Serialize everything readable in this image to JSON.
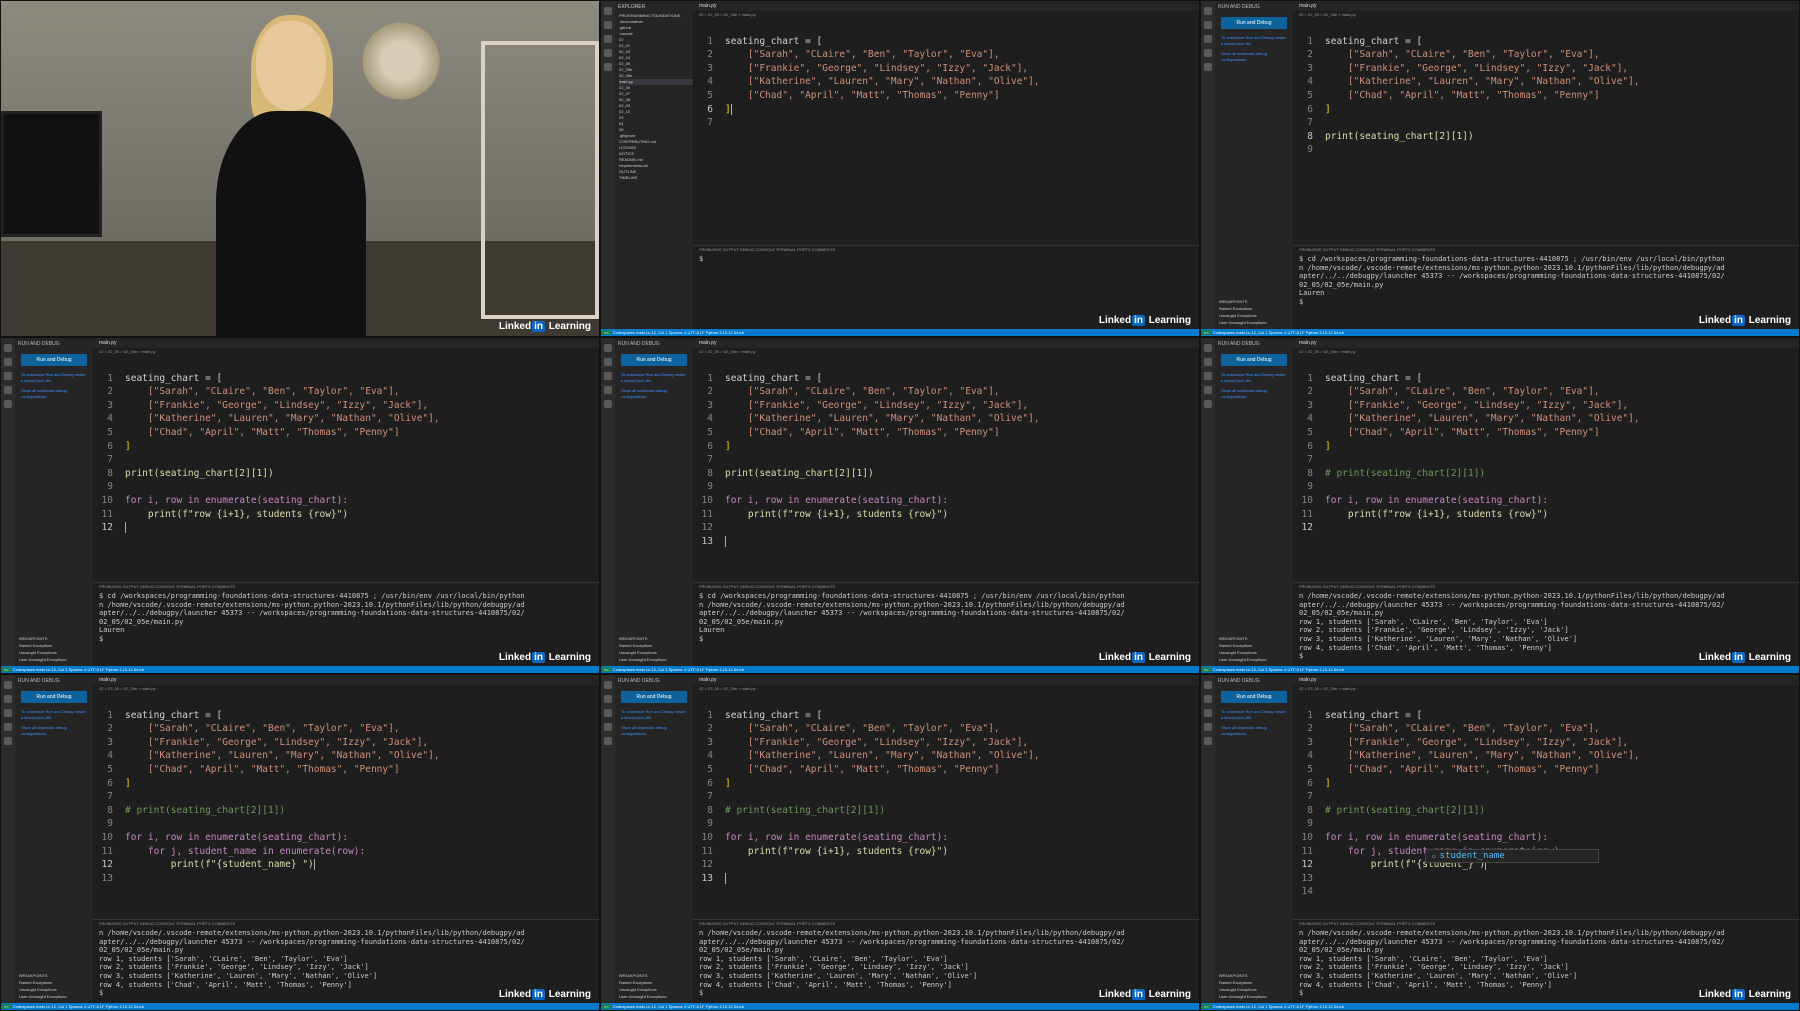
{
  "watermark": {
    "prefix": "Linked",
    "badge": "in",
    "suffix": "Learning"
  },
  "ui": {
    "run_title": "RUN AND DEBUG",
    "explorer_title": "EXPLORER",
    "run_button": "Run and Debug",
    "run_hint": "To customize Run and Debug create a launch.json file.",
    "show_auto": "Show all automatic debug configurations.",
    "tab_label": "main.py",
    "breadcrumb": "02 > 02_05 > 02_05e > main.py",
    "panel_tabs": "PROBLEMS   OUTPUT   DEBUG CONSOLE   TERMINAL   PORTS   COMMENTS",
    "breakpoints": [
      "BREAKPOINTS",
      "Raised Exceptions",
      "Uncaught Exceptions",
      "User Uncaught Exceptions"
    ],
    "status": "Codespaces   main   Ln 12, Col 1   Spaces: 4   UTF-8   LF   Python   3.10.12 64-bit"
  },
  "explorer_tree": [
    "PROGRAMMING-FOUNDATIONS",
    ".devcontainer",
    ".github",
    ".vscode",
    "02",
    "02_01",
    "02_03",
    "02_04",
    "02_05",
    "02_05b",
    "02_05e",
    "main.py",
    "02_06",
    "02_07",
    "02_08",
    "02_09",
    "02_10",
    "03",
    "04",
    "05",
    ".gitignore",
    "CONTRIBUTING.md",
    "LICENSE",
    "NOTICE",
    "README.md",
    "requirements.txt",
    "OUTLINE",
    "TIMELINE"
  ],
  "code": {
    "chart_open": "seating_chart = [",
    "row1": "[\"Sarah\", \"CLaire\", \"Ben\", \"Taylor\", \"Eva\"],",
    "row2": "[\"Frankie\", \"George\", \"Lindsey\", \"Izzy\", \"Jack\"],",
    "row3": "[\"Katherine\", \"Lauren\", \"Mary\", \"Nathan\", \"Olive\"],",
    "row4": "[\"Chad\", \"April\", \"Matt\", \"Thomas\", \"Penny\"]",
    "close": "]",
    "print_idx": "print(seating_chart[2][1])",
    "print_idx_c": "# print(seating_chart[2][1])",
    "for_i": "for i, row in enumerate(seating_chart):",
    "print_row": "print(f\"row {i+1}, students {row}\")",
    "for_j": "for j, student_name in enumerate(row):",
    "print_student": "print(f\"{student_name} \")",
    "print_student2": "print(f\"{student_}\")"
  },
  "terminal": {
    "prompt": "$",
    "cd_cmd": "$ cd /workspaces/programming-foundations-data-structures-4410875 ; /usr/bin/env /usr/local/bin/python",
    "cmd2": "n /home/vscode/.vscode-remote/extensions/ms-python.python-2023.10.1/pythonFiles/lib/python/debugpy/ad",
    "cmd3": "apter/../../debugpy/launcher 45373 -- /workspaces/programming-foundations-data-structures-4410875/02/",
    "cmd4": "02_05/02_05e/main.py",
    "lauren": "Lauren",
    "out1": "row 1, students ['Sarah', 'CLaire', 'Ben', 'Taylor', 'Eva']",
    "out2": "row 2, students ['Frankie', 'George', 'Lindsey', 'Izzy', 'Jack']",
    "out3": "row 3, students ['Katherine', 'Lauren', 'Mary', 'Nathan', 'Olive']",
    "out4": "row 4, students ['Chad', 'April', 'Matt', 'Thomas', 'Penny']"
  },
  "suggestion": "student_name"
}
